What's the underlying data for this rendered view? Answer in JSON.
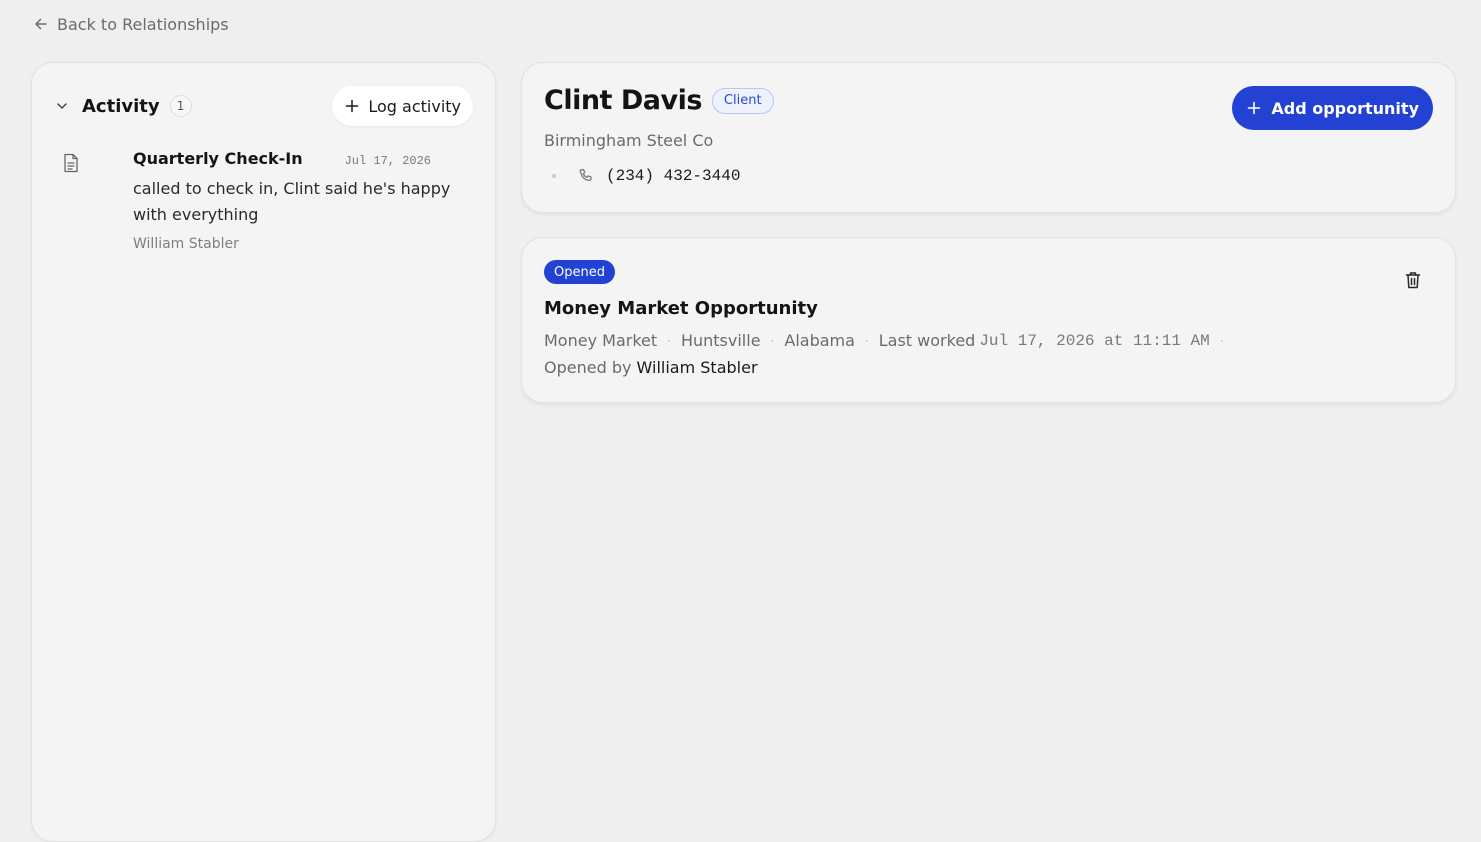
{
  "nav": {
    "back_label": "Back to Relationships"
  },
  "activity": {
    "title": "Activity",
    "count": "1",
    "log_label": "Log activity",
    "items": [
      {
        "title": "Quarterly Check-In",
        "date": "Jul 17, 2026",
        "note": "called to check in, Clint said he's happy with everything",
        "author": "William Stabler"
      }
    ]
  },
  "contact": {
    "name": "Clint Davis",
    "badge": "Client",
    "company": "Birmingham Steel Co",
    "phone": "(234) 432-3440",
    "add_opportunity_label": "Add opportunity"
  },
  "opportunity": {
    "status": "Opened",
    "title": "Money Market Opportunity",
    "product": "Money Market",
    "city": "Huntsville",
    "state": "Alabama",
    "last_worked_label": "Last worked",
    "last_worked_value": "Jul 17, 2026 at 11:11 AM",
    "opened_by_label": "Opened by",
    "opened_by": "William Stabler"
  },
  "colors": {
    "accent": "#2342d4",
    "background": "#efefef",
    "card": "#f4f4f4"
  },
  "icons": {
    "back": "arrow-left-icon",
    "collapse": "chevron-down-icon",
    "log": "plus-icon",
    "activity_item": "document-icon",
    "phone": "phone-icon",
    "add": "plus-icon",
    "delete": "trash-icon"
  }
}
